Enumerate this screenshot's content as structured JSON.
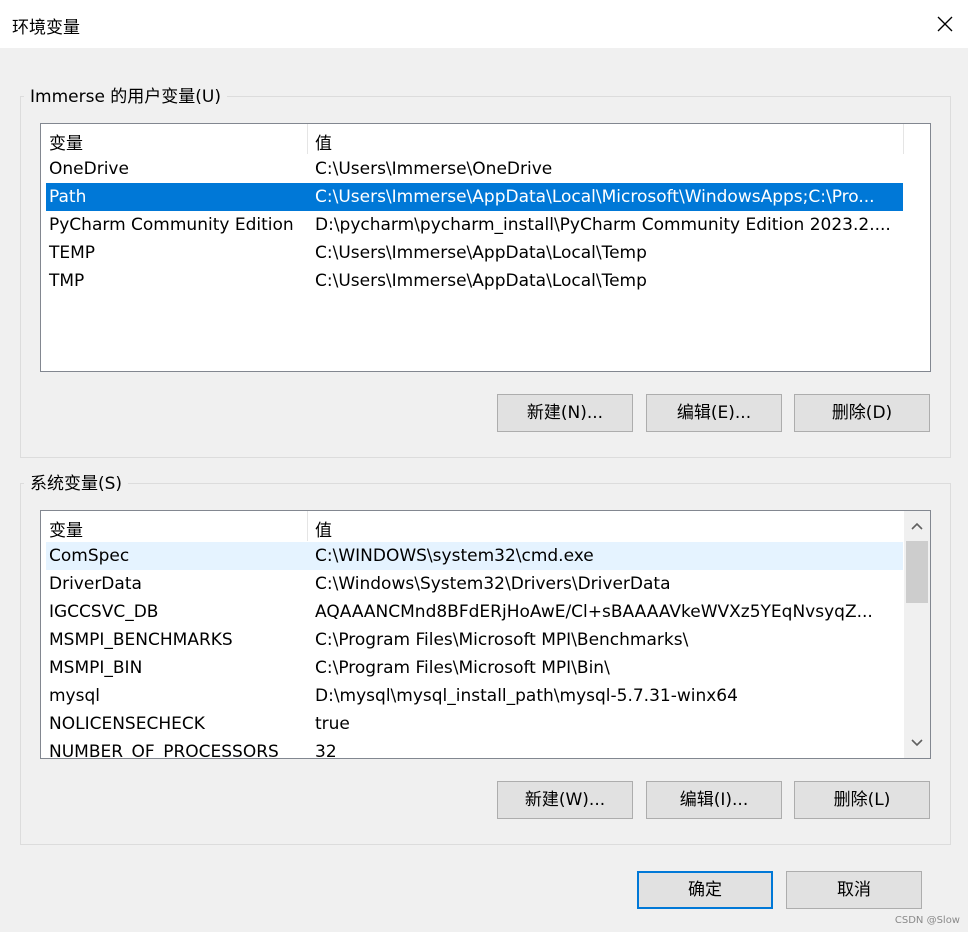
{
  "window": {
    "title": "环境变量"
  },
  "user_vars": {
    "group_label": "Immerse 的用户变量(U)",
    "columns": [
      "变量",
      "值"
    ],
    "rows": [
      {
        "name": "OneDrive",
        "value": "C:\\Users\\Immerse\\OneDrive"
      },
      {
        "name": "Path",
        "value": "C:\\Users\\Immerse\\AppData\\Local\\Microsoft\\WindowsApps;C:\\Pro..."
      },
      {
        "name": "PyCharm Community Edition",
        "value": "D:\\pycharm\\pycharm_install\\PyCharm Community Edition 2023.2...."
      },
      {
        "name": "TEMP",
        "value": "C:\\Users\\Immerse\\AppData\\Local\\Temp"
      },
      {
        "name": "TMP",
        "value": "C:\\Users\\Immerse\\AppData\\Local\\Temp"
      }
    ],
    "selected_index": 1,
    "buttons": {
      "new": "新建(N)...",
      "edit": "编辑(E)...",
      "delete": "删除(D)"
    }
  },
  "system_vars": {
    "group_label": "系统变量(S)",
    "columns": [
      "变量",
      "值"
    ],
    "rows": [
      {
        "name": "ComSpec",
        "value": "C:\\WINDOWS\\system32\\cmd.exe"
      },
      {
        "name": "DriverData",
        "value": "C:\\Windows\\System32\\Drivers\\DriverData"
      },
      {
        "name": "IGCCSVC_DB",
        "value": "AQAAANCMnd8BFdERjHoAwE/Cl+sBAAAAVkeWVXz5YEqNvsyqZ..."
      },
      {
        "name": "MSMPI_BENCHMARKS",
        "value": "C:\\Program Files\\Microsoft MPI\\Benchmarks\\"
      },
      {
        "name": "MSMPI_BIN",
        "value": "C:\\Program Files\\Microsoft MPI\\Bin\\"
      },
      {
        "name": "mysql",
        "value": "D:\\mysql\\mysql_install_path\\mysql-5.7.31-winx64"
      },
      {
        "name": "NOLICENSECHECK",
        "value": "true"
      },
      {
        "name": "NUMBER_OF_PROCESSORS",
        "value": "32"
      }
    ],
    "buttons": {
      "new": "新建(W)...",
      "edit": "编辑(I)...",
      "delete": "删除(L)"
    }
  },
  "footer": {
    "ok": "确定",
    "cancel": "取消"
  },
  "watermark": "CSDN @Slow",
  "colors": {
    "selection": "#0078d7",
    "hover": "#e5f3ff",
    "background": "#f0f0f0"
  }
}
